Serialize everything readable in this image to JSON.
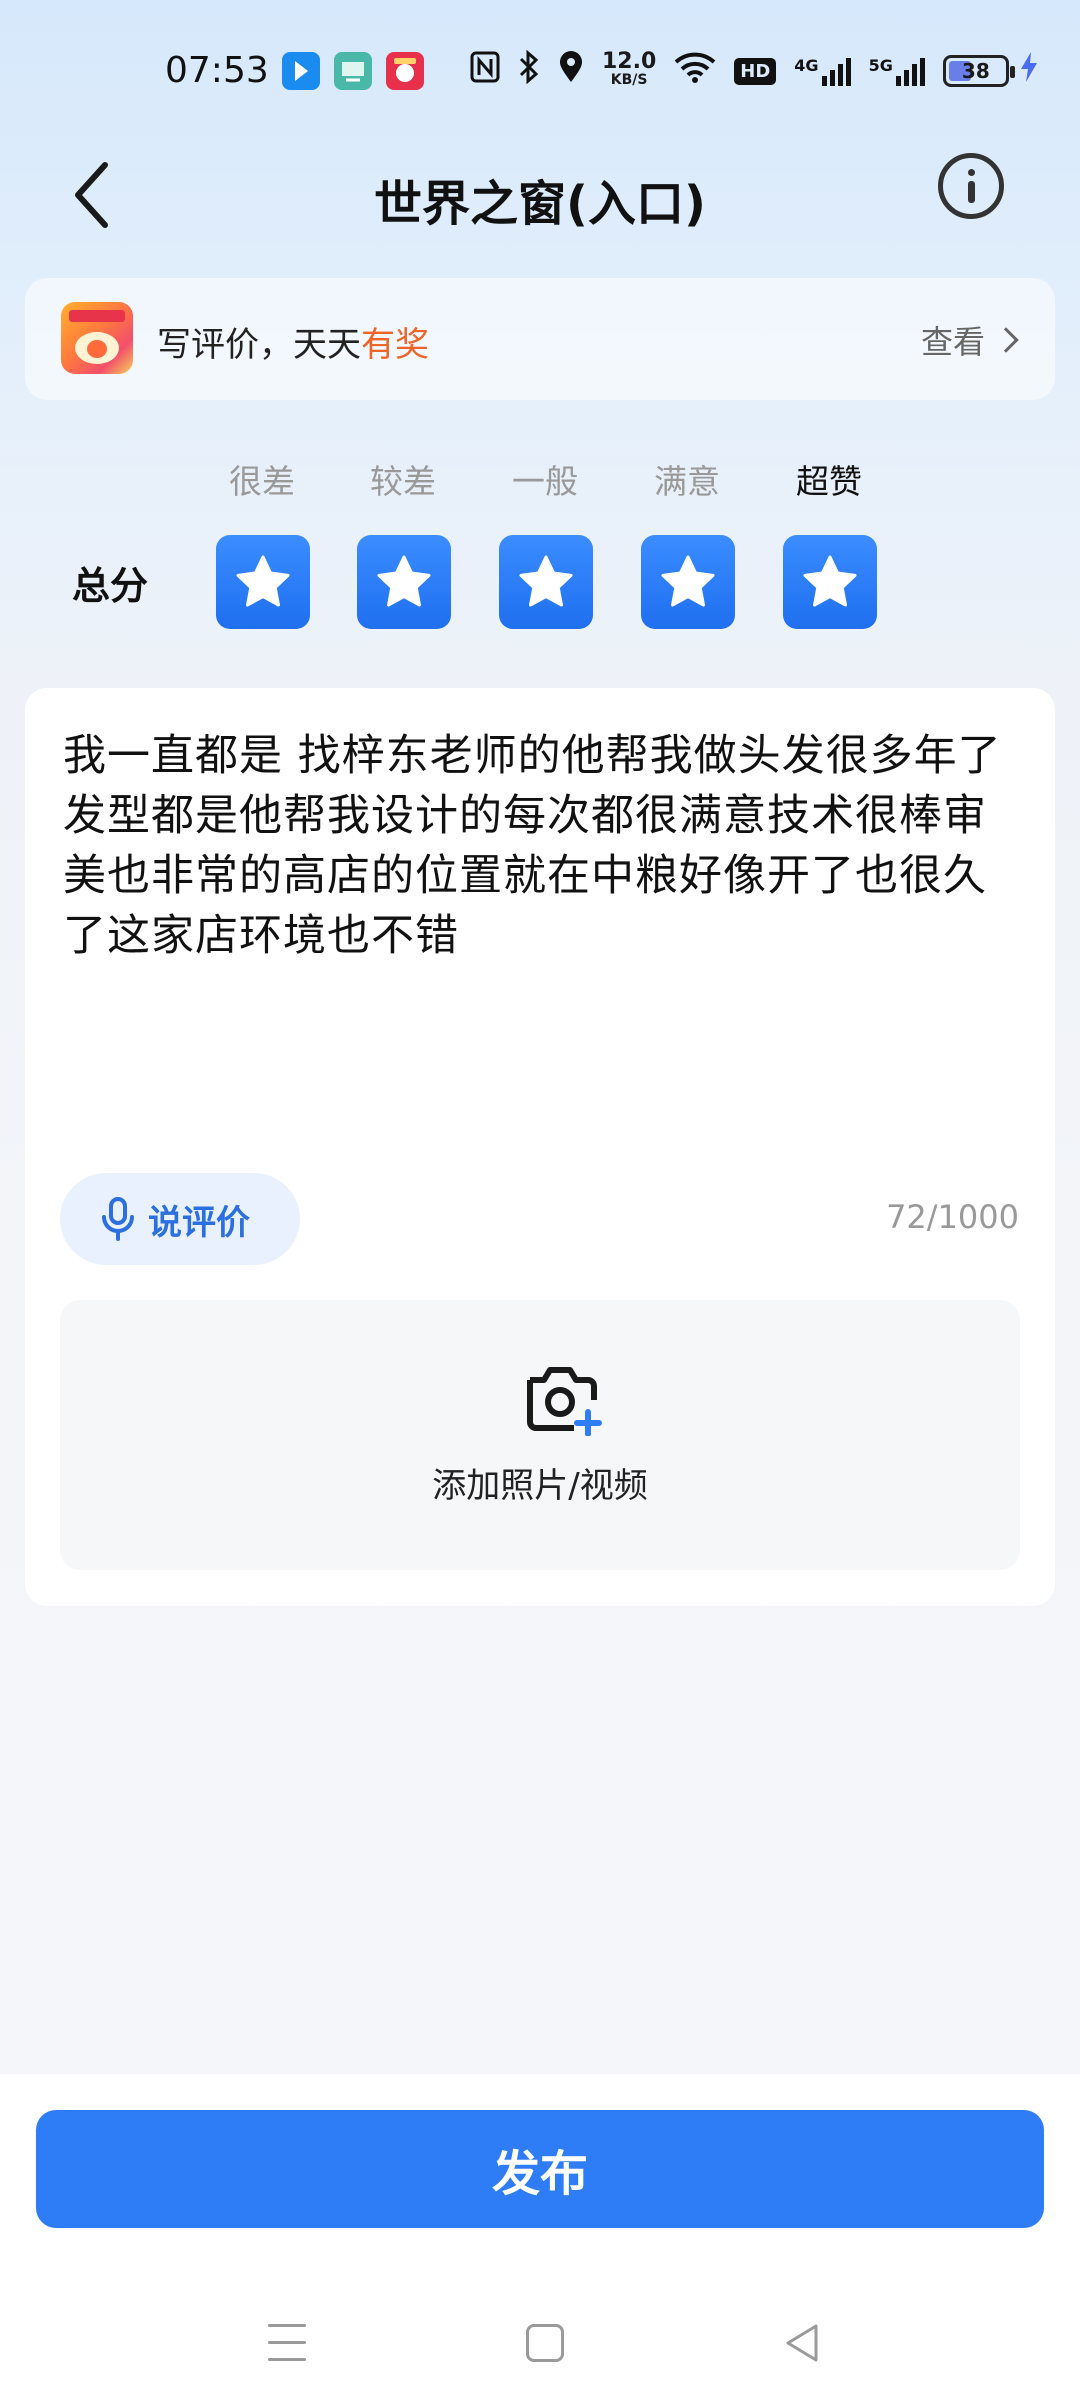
{
  "status_bar": {
    "time": "07:53",
    "net_speed_value": "12.0",
    "net_speed_unit": "KB/S",
    "hd_label": "HD",
    "net_4g": "4G",
    "net_5g": "5G",
    "battery": "38",
    "icons": [
      "app-notification-1-icon",
      "app-notification-2-icon",
      "app-notification-3-icon",
      "nfc-icon",
      "bluetooth-icon",
      "location-icon",
      "wifi-icon",
      "signal-icon",
      "battery-icon",
      "charging-icon"
    ]
  },
  "header": {
    "title": "世界之窗(入口)",
    "back_icon": "chevron-left-icon",
    "info_icon": "info-icon"
  },
  "promo": {
    "text_prefix": "写评价，天天",
    "text_highlight": "有奖",
    "link_label": "查看",
    "highlight_color": "#f06428"
  },
  "rating": {
    "label": "总分",
    "levels": [
      "很差",
      "较差",
      "一般",
      "满意",
      "超赞"
    ],
    "selected_label": "超赞",
    "score": 5,
    "max_score": 5,
    "star_color": "#2a7cf6"
  },
  "review": {
    "text": "我一直都是 找梓东老师的他帮我做头发很多年了发型都是他帮我设计的每次都很满意技术很棒审美也非常的高店的位置就在中粮好像开了也很久了这家店环境也不错",
    "voice_label": "说评价",
    "char_count": "72/1000",
    "upload_label": "添加照片/视频"
  },
  "actions": {
    "publish_label": "发布",
    "accent_color": "#2e7cf6"
  }
}
